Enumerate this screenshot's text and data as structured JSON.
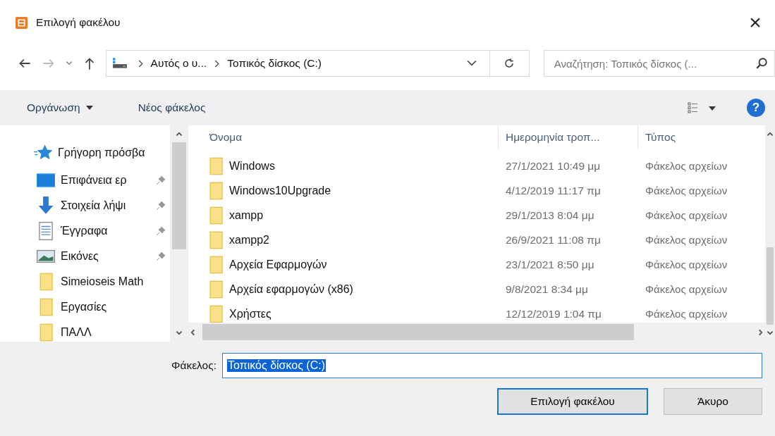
{
  "window": {
    "title": "Επιλογή φακέλου",
    "close": "×"
  },
  "address": {
    "segments": [
      "Αυτός ο υ...",
      "Τοπικός δίσκος (C:)"
    ]
  },
  "search": {
    "placeholder": "Αναζήτηση: Τοπικός δίσκος (..."
  },
  "toolbar": {
    "organize": "Οργάνωση",
    "new_folder": "Νέος φάκελος",
    "help": "?"
  },
  "sidebar": {
    "items": [
      {
        "label": "Γρήγορη πρόσβα",
        "kind": "star",
        "pinned": false
      },
      {
        "label": "Επιφάνεια ερ",
        "kind": "desktop",
        "pinned": true
      },
      {
        "label": "Στοιχεία λήψι",
        "kind": "download",
        "pinned": true
      },
      {
        "label": "Έγγραφα",
        "kind": "document",
        "pinned": true
      },
      {
        "label": "Εικόνες",
        "kind": "picture",
        "pinned": true
      },
      {
        "label": "Simeioseis Math",
        "kind": "folder",
        "pinned": false
      },
      {
        "label": "Εργασίες",
        "kind": "folder",
        "pinned": false
      },
      {
        "label": "ΠΑΛΛ",
        "kind": "folder",
        "pinned": false
      }
    ]
  },
  "table": {
    "columns": [
      "Όνομα",
      "Ημερομηνία τροπ...",
      "Τύπος"
    ],
    "rows": [
      {
        "name": "Windows",
        "date": "27/1/2021 10:49 μμ",
        "type": "Φάκελος αρχείων"
      },
      {
        "name": "Windows10Upgrade",
        "date": "4/12/2019 11:17 πμ",
        "type": "Φάκελος αρχείων"
      },
      {
        "name": "xampp",
        "date": "29/1/2013 8:04 μμ",
        "type": "Φάκελος αρχείων"
      },
      {
        "name": "xampp2",
        "date": "26/9/2021 11:08 πμ",
        "type": "Φάκελος αρχείων"
      },
      {
        "name": "Αρχεία Εφαρμογών",
        "date": "23/1/2021 8:50 μμ",
        "type": "Φάκελος αρχείων"
      },
      {
        "name": "Αρχεία εφαρμογών (x86)",
        "date": "9/8/2021 8:34 μμ",
        "type": "Φάκελος αρχείων"
      },
      {
        "name": "Χρήστες",
        "date": "12/12/2019 1:04 πμ",
        "type": "Φάκελος αρχείων"
      }
    ]
  },
  "folder_field": {
    "label": "Φάκελος:",
    "value": "Τοπικός δίσκος (C:)",
    "selected": true
  },
  "buttons": [
    {
      "label": "Επιλογή φακέλου",
      "default": true
    },
    {
      "label": "Άκυρο",
      "default": false
    }
  ]
}
